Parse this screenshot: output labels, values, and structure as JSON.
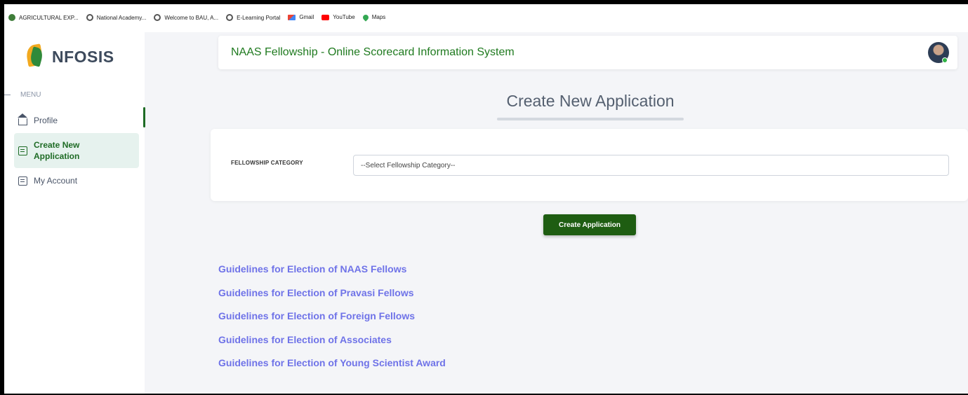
{
  "bookmarks": [
    {
      "label": "AGRICULTURAL EXP...",
      "icon": "leaf-icon"
    },
    {
      "label": "National Academy...",
      "icon": "globe-icon"
    },
    {
      "label": "Welcome to BAU, A...",
      "icon": "globe-icon"
    },
    {
      "label": "E-Learning Portal",
      "icon": "globe-icon"
    },
    {
      "label": "Gmail",
      "icon": "gmail-icon"
    },
    {
      "label": "YouTube",
      "icon": "youtube-icon"
    },
    {
      "label": "Maps",
      "icon": "maps-icon"
    }
  ],
  "sidebar": {
    "brand": "NFOSIS",
    "menu_label": "MENU",
    "items": [
      {
        "label": "Profile",
        "icon": "home-icon",
        "active": false
      },
      {
        "label": "Create New Application",
        "icon": "document-icon",
        "active": true
      },
      {
        "label": "My Account",
        "icon": "document-icon",
        "active": false
      }
    ]
  },
  "header": {
    "title": "NAAS Fellowship - Online Scorecard Information System"
  },
  "main": {
    "page_title": "Create New Application",
    "form": {
      "label": "FELLOWSHIP CATEGORY",
      "select_value": "--Select Fellowship Category--"
    },
    "create_button": "Create Application",
    "guideline_links": [
      "Guidelines for Election of NAAS Fellows",
      "Guidelines for Election of Pravasi Fellows",
      "Guidelines for Election of Foreign Fellows",
      "Guidelines for Election of Associates",
      "Guidelines for Election of Young Scientist Award"
    ]
  },
  "colors": {
    "brand_green": "#1e6b25",
    "button_green": "#1e5d12",
    "link_purple": "#6f73e8",
    "active_bg": "#e6f2ee"
  }
}
